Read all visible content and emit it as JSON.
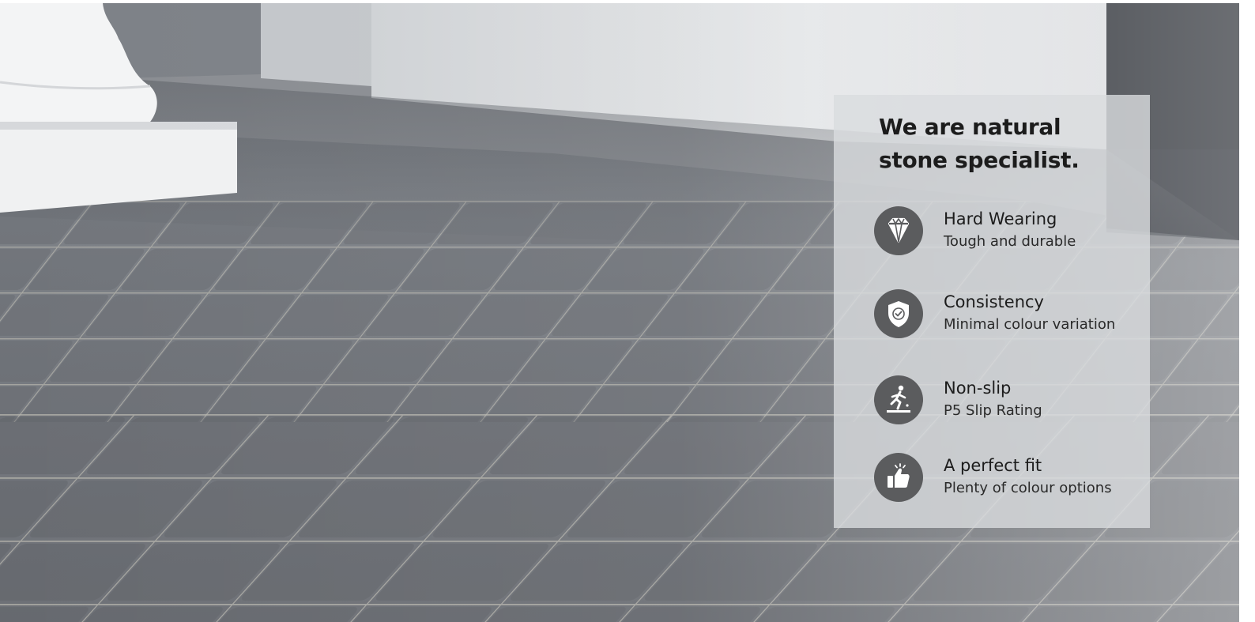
{
  "hero": {
    "image": "paved-natural-stone-patio-photo"
  },
  "panel": {
    "title_line1": "We are natural",
    "title_line2": "stone specialist.",
    "features": [
      {
        "icon": "diamond-icon",
        "title": "Hard Wearing",
        "subtitle": "Tough and durable"
      },
      {
        "icon": "shield-check-icon",
        "title": "Consistency",
        "subtitle": "Minimal colour variation"
      },
      {
        "icon": "slip-person-icon",
        "title": "Non-slip",
        "subtitle": "P5 Slip Rating"
      },
      {
        "icon": "thumbs-up-icon",
        "title": "A perfect fit",
        "subtitle": "Plenty of colour options"
      }
    ]
  },
  "colors": {
    "badge": "#5b5c5e",
    "text": "#1c1c1c",
    "panel": "#dadcdf"
  }
}
